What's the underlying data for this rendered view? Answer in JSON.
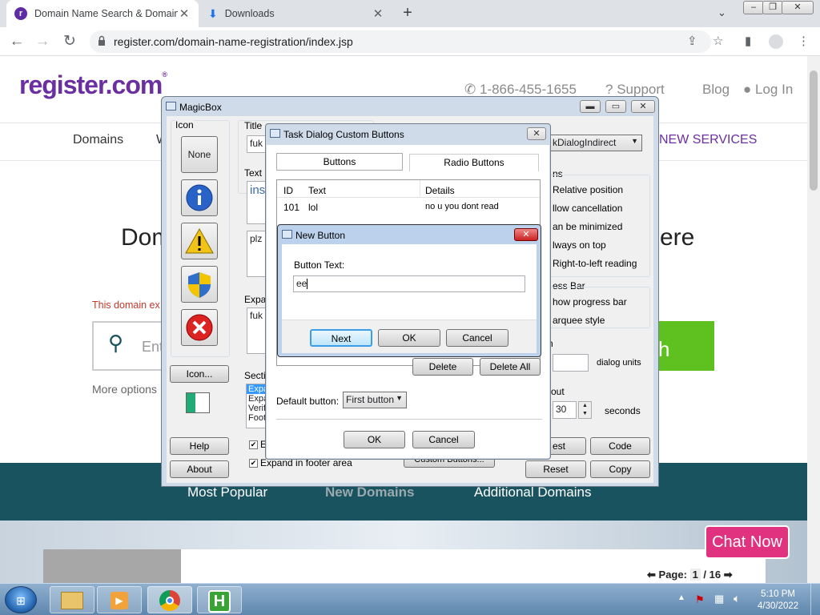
{
  "browser": {
    "tabs": [
      {
        "title": "Domain Name Search & Domain"
      },
      {
        "title": "Downloads"
      }
    ],
    "url": "register.com/domain-name-registration/index.jsp"
  },
  "site": {
    "logo": "register.com",
    "logo_mark": "®",
    "phone": "1-866-455-1655",
    "support": "Support",
    "blog": "Blog",
    "login": "Log In",
    "nav": [
      "Domains",
      "W",
      "NEW SERVICES"
    ],
    "heading_left": "Dom",
    "heading_right": "ere",
    "exists_text": "This domain ex",
    "search_placeholder": "Ent",
    "search_button": "h",
    "more_options": "More options",
    "bottom_tabs": [
      "Most Popular",
      "New Domains",
      "Additional Domains"
    ],
    "chat": "Chat Now",
    "page_label": "Page:",
    "page_current": "1",
    "page_total": "/ 16"
  },
  "magicbox": {
    "title": "MagicBox",
    "icon_group": "Icon",
    "none_btn": "None",
    "icon_btn": "Icon...",
    "help_btn": "Help",
    "about_btn": "About",
    "title_label": "Title",
    "title_value": "fuk",
    "text_label": "Text",
    "text_value": "ins",
    "text_value2": "plz",
    "expand_label": "Expan",
    "expand_value": "fuk",
    "section_label": "Sectio",
    "section_items": [
      "Expa",
      "Expa",
      "Verif",
      "Foot"
    ],
    "check1": "E",
    "check2": "Expand in footer area",
    "custom_btn": "Custom Buttons...",
    "func_value": "kDialogIndirect",
    "options_label": "ns",
    "options": [
      "Relative position",
      "llow cancellation",
      "an be minimized",
      "lways on top",
      "Right-to-left reading"
    ],
    "progress_label": "ess Bar",
    "progress_options": [
      "how progress bar",
      "arquee style"
    ],
    "width_label": "n",
    "dialog_units": "dialog units",
    "timeout_label": "out",
    "timeout_value": "30",
    "seconds": "seconds",
    "test_btn": "est",
    "code_btn": "Code",
    "reset_btn": "Reset",
    "copy_btn": "Copy"
  },
  "task_dialog": {
    "title": "Task Dialog Custom Buttons",
    "tab_buttons": "Buttons",
    "tab_radio": "Radio Buttons",
    "columns": [
      "ID",
      "Text",
      "Details"
    ],
    "rows": [
      {
        "id": "101",
        "text": "lol",
        "details": "no u you dont read"
      }
    ],
    "delete_btn": "Delete",
    "delete_all_btn": "Delete All",
    "default_label": "Default button:",
    "default_value": "First button",
    "ok_btn": "OK",
    "cancel_btn": "Cancel"
  },
  "new_button": {
    "title": "New Button",
    "label": "Button Text:",
    "value": "ee",
    "next_btn": "Next",
    "ok_btn": "OK",
    "cancel_btn": "Cancel"
  },
  "taskbar": {
    "time": "5:10 PM",
    "date": "4/30/2022"
  },
  "colors": {
    "brand": "#6b2fa0",
    "teal": "#1a5360",
    "search_green": "#5fc11f",
    "chat_pink": "#e0327f"
  }
}
